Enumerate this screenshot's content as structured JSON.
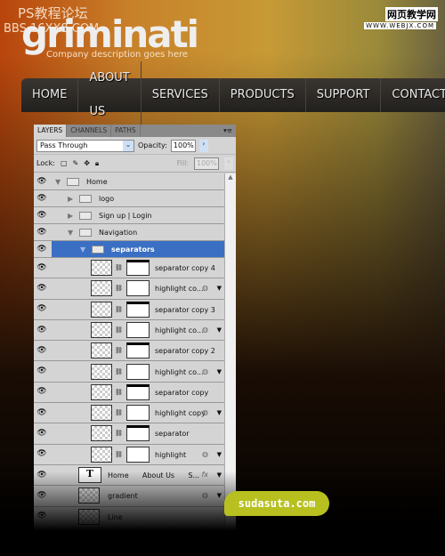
{
  "watermarks": {
    "left_title": "PS教程论坛",
    "left_sub": "BBS.16XX8.COM",
    "right_title": "网页教学网",
    "right_sub": "WWW.WEBJX.COM"
  },
  "site": {
    "logo": "griminati",
    "tagline": "Company description goes here"
  },
  "nav": [
    "HOME",
    "ABOUT US",
    "SERVICES",
    "PRODUCTS",
    "SUPPORT",
    "CONTACT"
  ],
  "panel": {
    "tabs": [
      "LAYERS",
      "CHANNELS",
      "PATHS"
    ],
    "menu_icon": "panel-menu-icon",
    "blend_mode": "Pass Through",
    "opacity_label": "Opacity:",
    "opacity": "100%",
    "lock_label": "Lock:",
    "fill_label": "Fill:",
    "fill": "100%",
    "layers": [
      {
        "name": "Home",
        "type": "group",
        "indent": 0,
        "expanded": true
      },
      {
        "name": "logo",
        "type": "group",
        "indent": 1,
        "expanded": false
      },
      {
        "name": "Sign up   |   Login",
        "type": "group",
        "indent": 1,
        "expanded": false
      },
      {
        "name": "Navigation",
        "type": "group",
        "indent": 1,
        "expanded": true
      },
      {
        "name": "separators",
        "type": "group",
        "indent": 2,
        "expanded": true,
        "selected": true
      },
      {
        "name": "separator copy 4",
        "type": "masked",
        "mask": "top"
      },
      {
        "name": "highlight co...",
        "type": "masked",
        "fx": true
      },
      {
        "name": "separator copy 3",
        "type": "masked",
        "mask": "top"
      },
      {
        "name": "highlight co...",
        "type": "masked",
        "fx": true
      },
      {
        "name": "separator copy 2",
        "type": "masked",
        "mask": "top"
      },
      {
        "name": "highlight co...",
        "type": "masked",
        "fx": true
      },
      {
        "name": "separator copy",
        "type": "masked",
        "mask": "top"
      },
      {
        "name": "highlight copy",
        "type": "masked",
        "fx": true
      },
      {
        "name": "separator",
        "type": "masked",
        "mask": "top"
      },
      {
        "name": "highlight",
        "type": "masked",
        "fx": true
      },
      {
        "name": "Home      About Us      S...",
        "type": "text",
        "fx_label": "fx"
      },
      {
        "name": "gradient",
        "type": "smart",
        "fx": true
      },
      {
        "name": "Line",
        "type": "smart"
      }
    ]
  },
  "badge": "sudasuta.com"
}
